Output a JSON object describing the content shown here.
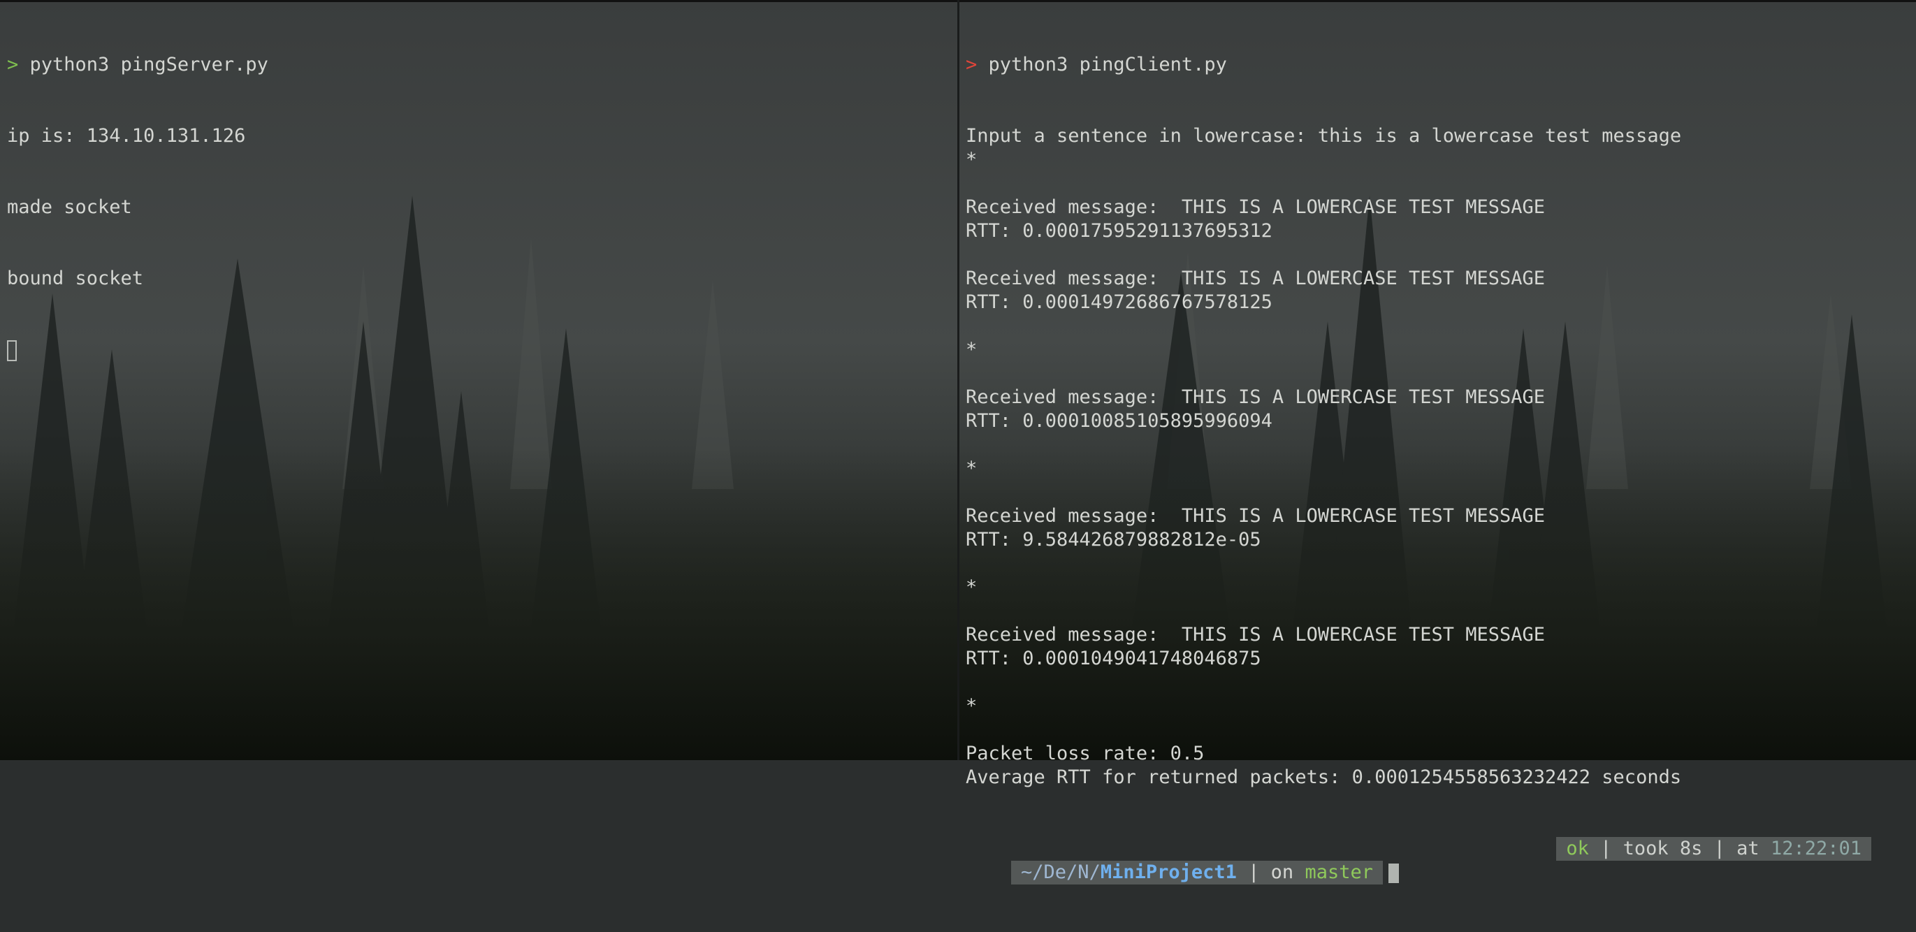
{
  "left_pane": {
    "prompt_symbol": ">",
    "command": " python3 pingServer.py",
    "lines": [
      "ip is: 134.10.131.126",
      "made socket",
      "bound socket"
    ]
  },
  "right_pane": {
    "prompt_symbol": ">",
    "command": " python3 pingClient.py",
    "lines": [
      "Input a sentence in lowercase: this is a lowercase test message",
      "*",
      "",
      "Received message:  THIS IS A LOWERCASE TEST MESSAGE",
      "RTT: 0.00017595291137695312",
      "",
      "Received message:  THIS IS A LOWERCASE TEST MESSAGE",
      "RTT: 0.00014972686767578125",
      "",
      "*",
      "",
      "Received message:  THIS IS A LOWERCASE TEST MESSAGE",
      "RTT: 0.00010085105895996094",
      "",
      "*",
      "",
      "Received message:  THIS IS A LOWERCASE TEST MESSAGE",
      "RTT: 9.584426879882812e-05",
      "",
      "*",
      "",
      "Received message:  THIS IS A LOWERCASE TEST MESSAGE",
      "RTT: 0.0001049041748046875",
      "",
      "*",
      "",
      "Packet loss rate: 0.5",
      "Average RTT for returned packets: 0.0001254558563232422 seconds"
    ],
    "statusline": {
      "path_prefix": "~/De/N/",
      "path_current": "MiniProject1",
      "sep_on": " | on ",
      "branch": "master",
      "status_ok": "ok",
      "took": " | took 8s | at ",
      "time": "12:22:01"
    }
  },
  "colors": {
    "prompt_left": "#7fbf4f",
    "prompt_right": "#e0453a",
    "path": "#6fb0ee",
    "branch": "#8fc95b"
  }
}
